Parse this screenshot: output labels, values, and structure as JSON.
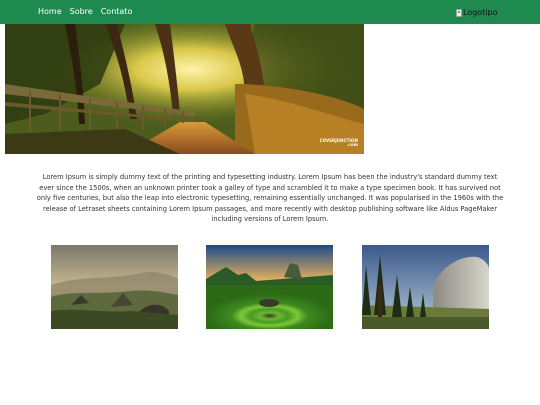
{
  "nav": {
    "items": [
      {
        "label": "Home"
      },
      {
        "label": "Sobre"
      },
      {
        "label": "Contato"
      }
    ],
    "logo_alt": "Logotipo"
  },
  "hero": {
    "watermark_line1": "COVERJUNCTION",
    "watermark_line2": ".com"
  },
  "content": {
    "paragraph": "Lorem Ipsum is simply dummy text of the printing and typesetting industry. Lorem Ipsum has been the industry's standard dummy text ever since the 1500s, when an unknown printer took a galley of type and scrambled it to make a type specimen book. It has survived not only five centuries, but also the leap into electronic typesetting, remaining essentially unchanged. It was popularised in the 1960s with the release of Letraset sheets containing Lorem Ipsum passages, and more recently with desktop publishing software like Aldus PageMaker including versions of Lorem Ipsum."
  },
  "colors": {
    "navbar": "#1e8a50",
    "nav_text": "#ffffff",
    "body_text": "#333333"
  }
}
